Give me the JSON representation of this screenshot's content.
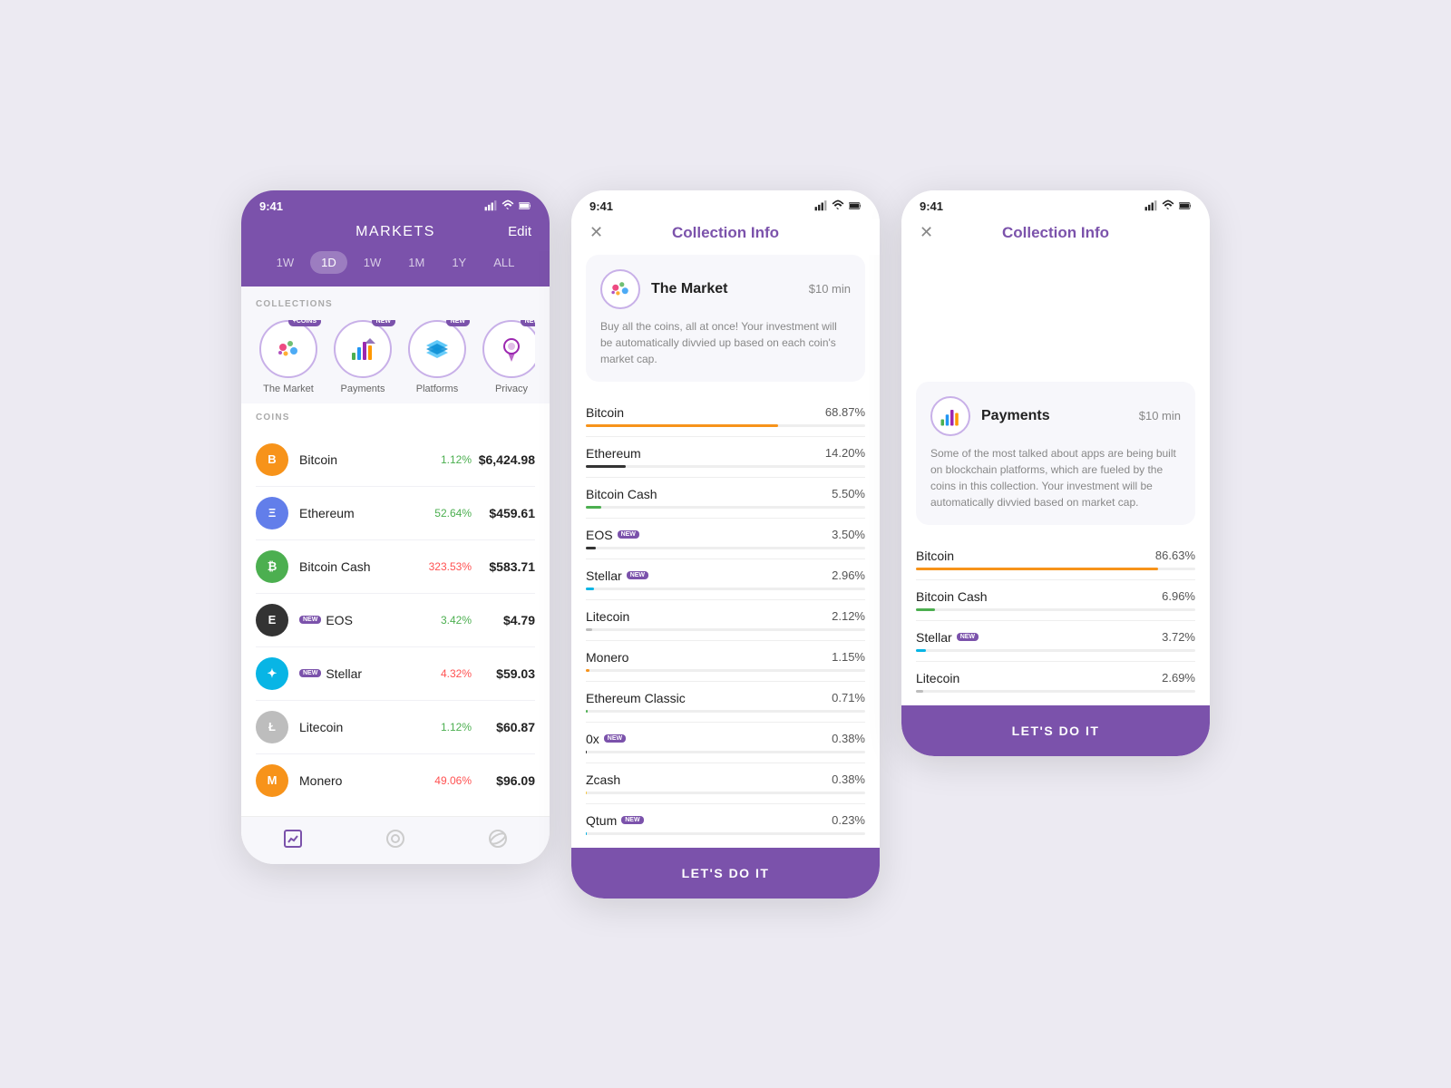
{
  "screen1": {
    "time": "9:41",
    "title": "MARKETS",
    "edit": "Edit",
    "timeFilters": [
      "1W",
      "1D",
      "1W",
      "1M",
      "1Y",
      "ALL"
    ],
    "activeFilter": "1D",
    "collectionsLabel": "COLLECTIONS",
    "coinsLabel": "COINS",
    "collections": [
      {
        "name": "The Market",
        "badge": "+COINS",
        "hasBadge": true,
        "type": "market"
      },
      {
        "name": "Payments",
        "badge": "NEW",
        "hasBadge": true,
        "type": "payments"
      },
      {
        "name": "Platforms",
        "badge": "NEW",
        "hasBadge": true,
        "type": "platforms"
      },
      {
        "name": "Privacy",
        "badge": "NEW",
        "hasBadge": true,
        "type": "privacy"
      }
    ],
    "coins": [
      {
        "name": "Bitcoin",
        "symbol": "B",
        "color": "#f7931a",
        "change": "1.12%",
        "price": "$6,424.98",
        "positive": true,
        "isNew": false
      },
      {
        "name": "Ethereum",
        "symbol": "Ξ",
        "color": "#627eea",
        "change": "52.64%",
        "price": "$459.61",
        "positive": true,
        "isNew": false
      },
      {
        "name": "Bitcoin Cash",
        "symbol": "₿",
        "color": "#4caf50",
        "change": "323.53%",
        "price": "$583.71",
        "positive": false,
        "isNew": false
      },
      {
        "name": "EOS",
        "symbol": "E",
        "color": "#333",
        "change": "3.42%",
        "price": "$4.79",
        "positive": true,
        "isNew": true
      },
      {
        "name": "Stellar",
        "symbol": "✦",
        "color": "#08b5e5",
        "change": "4.32%",
        "price": "$59.03",
        "positive": false,
        "isNew": true
      },
      {
        "name": "Litecoin",
        "symbol": "Ł",
        "color": "#bdbdbd",
        "change": "1.12%",
        "price": "$60.87",
        "positive": true,
        "isNew": false
      },
      {
        "name": "Monero",
        "symbol": "M",
        "color": "#f7931a",
        "change": "49.06%",
        "price": "$96.09",
        "positive": false,
        "isNew": false
      }
    ],
    "bottomNav": [
      "chart-icon",
      "circle-icon",
      "planet-icon"
    ]
  },
  "screen2": {
    "time": "9:41",
    "title": "Collection Info",
    "closeLabel": "✕",
    "card": {
      "name": "The Market",
      "min": "$10 min",
      "desc": "Buy all the coins, all at once! Your investment will be automatically divvied up based on each coin's market cap.",
      "type": "market"
    },
    "coins": [
      {
        "name": "Bitcoin",
        "pct": "68.87%",
        "pctVal": 68.87,
        "color": "#f7931a",
        "isNew": false
      },
      {
        "name": "Ethereum",
        "pct": "14.20%",
        "pctVal": 14.2,
        "color": "#333",
        "isNew": false
      },
      {
        "name": "Bitcoin Cash",
        "pct": "5.50%",
        "pctVal": 5.5,
        "color": "#4caf50",
        "isNew": false
      },
      {
        "name": "EOS",
        "pct": "3.50%",
        "pctVal": 3.5,
        "color": "#333",
        "isNew": true
      },
      {
        "name": "Stellar",
        "pct": "2.96%",
        "pctVal": 2.96,
        "color": "#08b5e5",
        "isNew": true
      },
      {
        "name": "Litecoin",
        "pct": "2.12%",
        "pctVal": 2.12,
        "color": "#bdbdbd",
        "isNew": false
      },
      {
        "name": "Monero",
        "pct": "1.15%",
        "pctVal": 1.15,
        "color": "#f7931a",
        "isNew": false
      },
      {
        "name": "Ethereum Classic",
        "pct": "0.71%",
        "pctVal": 0.71,
        "color": "#4caf50",
        "isNew": false
      },
      {
        "name": "0x",
        "pct": "0.38%",
        "pctVal": 0.38,
        "color": "#333",
        "isNew": true
      },
      {
        "name": "Zcash",
        "pct": "0.38%",
        "pctVal": 0.38,
        "color": "#f7c948",
        "isNew": false
      },
      {
        "name": "Qtum",
        "pct": "0.23%",
        "pctVal": 0.23,
        "color": "#08b5e5",
        "isNew": true
      }
    ],
    "ctaLabel": "LET'S DO IT"
  },
  "screen3": {
    "time": "9:41",
    "title": "Collection Info",
    "closeLabel": "✕",
    "card": {
      "name": "Payments",
      "min": "$10 min",
      "desc": "Some of the most talked about apps are being built on blockchain platforms, which are fueled by the coins in this collection. Your investment will be automatically divvied based on market cap.",
      "type": "payments"
    },
    "coins": [
      {
        "name": "Bitcoin",
        "pct": "86.63%",
        "pctVal": 86.63,
        "color": "#f7931a",
        "isNew": false
      },
      {
        "name": "Bitcoin Cash",
        "pct": "6.96%",
        "pctVal": 6.96,
        "color": "#4caf50",
        "isNew": false
      },
      {
        "name": "Stellar",
        "pct": "3.72%",
        "pctVal": 3.72,
        "color": "#08b5e5",
        "isNew": true
      },
      {
        "name": "Litecoin",
        "pct": "2.69%",
        "pctVal": 2.69,
        "color": "#bdbdbd",
        "isNew": false
      }
    ],
    "ctaLabel": "LET'S DO IT"
  }
}
